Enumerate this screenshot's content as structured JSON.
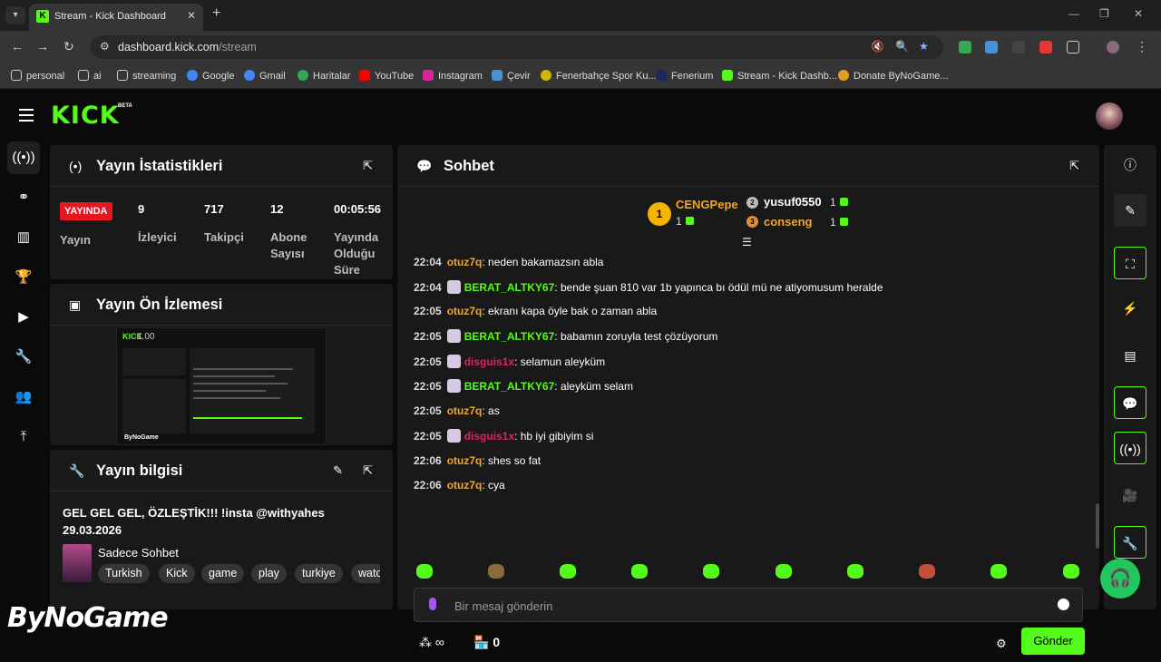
{
  "browser": {
    "tab_title": "Stream - Kick Dashboard",
    "url_host": "dashboard.kick.com",
    "url_path": "/stream",
    "bookmarks": [
      "personal",
      "ai",
      "streaming",
      "Google",
      "Gmail",
      "Haritalar",
      "YouTube",
      "Instagram",
      "Çevir",
      "Fenerbahçe Spor Ku...",
      "Fenerium",
      "Stream - Kick Dashb...",
      "Donate ByNoGame..."
    ]
  },
  "header": {
    "logo": "KICK",
    "beta": "BETA"
  },
  "stats": {
    "title": "Yayın İstatistikleri",
    "live_badge": "YAYINDA",
    "status_label": "Yayın",
    "viewers_value": "9",
    "viewers_label": "İzleyici",
    "followers_value": "717",
    "followers_label": "Takipçi",
    "subs_value": "12",
    "subs_label_1": "Abone",
    "subs_label_2": "Sayısı",
    "duration_value": "00:05:56",
    "duration_label_1": "Yayında",
    "duration_label_2": "Olduğu",
    "duration_label_3": "Süre"
  },
  "preview": {
    "title": "Yayın Ön İzlemesi",
    "thumb_logo": "KICK",
    "thumb_number": "1.00",
    "thumb_brand": "ByNoGame"
  },
  "info": {
    "title": "Yayın bilgisi",
    "stream_title": "GEL GEL GEL, ÖZLEŞTİK!!! !insta @withyahes 29.03.2026",
    "category": "Sadece Sohbet",
    "tags": [
      "Turkish",
      "Kick",
      "game",
      "play",
      "turkiye",
      "wato"
    ]
  },
  "chat": {
    "title": "Sohbet",
    "top_gifters": [
      {
        "rank": "1",
        "name": "CENGPepe",
        "count": "1"
      },
      {
        "rank": "2",
        "name": "yusuf0550",
        "count": "1"
      },
      {
        "rank": "3",
        "name": "conseng",
        "count": "1"
      }
    ],
    "messages": [
      {
        "time": "22:04",
        "user": "otuz7q",
        "color": "#f5a623",
        "badge": false,
        "text": "neden bakamazsın abla"
      },
      {
        "time": "22:04",
        "user": "BERAT_ALTKY67",
        "color": "#53fc18",
        "badge": true,
        "text": "bende şuan 810 var 1b yapınca bı ödül mü ne atiyomusum heralde"
      },
      {
        "time": "22:05",
        "user": "otuz7q",
        "color": "#f5a623",
        "badge": false,
        "text": "ekranı kapa öyle bak o zaman abla"
      },
      {
        "time": "22:05",
        "user": "BERAT_ALTKY67",
        "color": "#53fc18",
        "badge": true,
        "text": "babamın zoruyla test çözüyorum"
      },
      {
        "time": "22:05",
        "user": "disguis1x",
        "color": "#e0245e",
        "badge": true,
        "text": "selamun aleyküm"
      },
      {
        "time": "22:05",
        "user": "BERAT_ALTKY67",
        "color": "#53fc18",
        "badge": true,
        "text": "aleyküm selam"
      },
      {
        "time": "22:05",
        "user": "otuz7q",
        "color": "#f5a623",
        "badge": false,
        "text": "as"
      },
      {
        "time": "22:05",
        "user": "disguis1x",
        "color": "#e0245e",
        "badge": true,
        "text": "hb iyi gibiyim si"
      },
      {
        "time": "22:06",
        "user": "otuz7q",
        "color": "#f5a623",
        "badge": false,
        "text": "shes so fat"
      },
      {
        "time": "22:06",
        "user": "otuz7q",
        "color": "#f5a623",
        "badge": false,
        "text": "cya"
      }
    ],
    "input_placeholder": "Bir mesaj gönderin",
    "points": "∞",
    "store_count": "0",
    "send_label": "Gönder"
  },
  "watermark": "ByNoGame",
  "colors": {
    "accent": "#53fc18",
    "live": "#e8161f",
    "bg": "#0a0a0a",
    "card": "#191919"
  }
}
